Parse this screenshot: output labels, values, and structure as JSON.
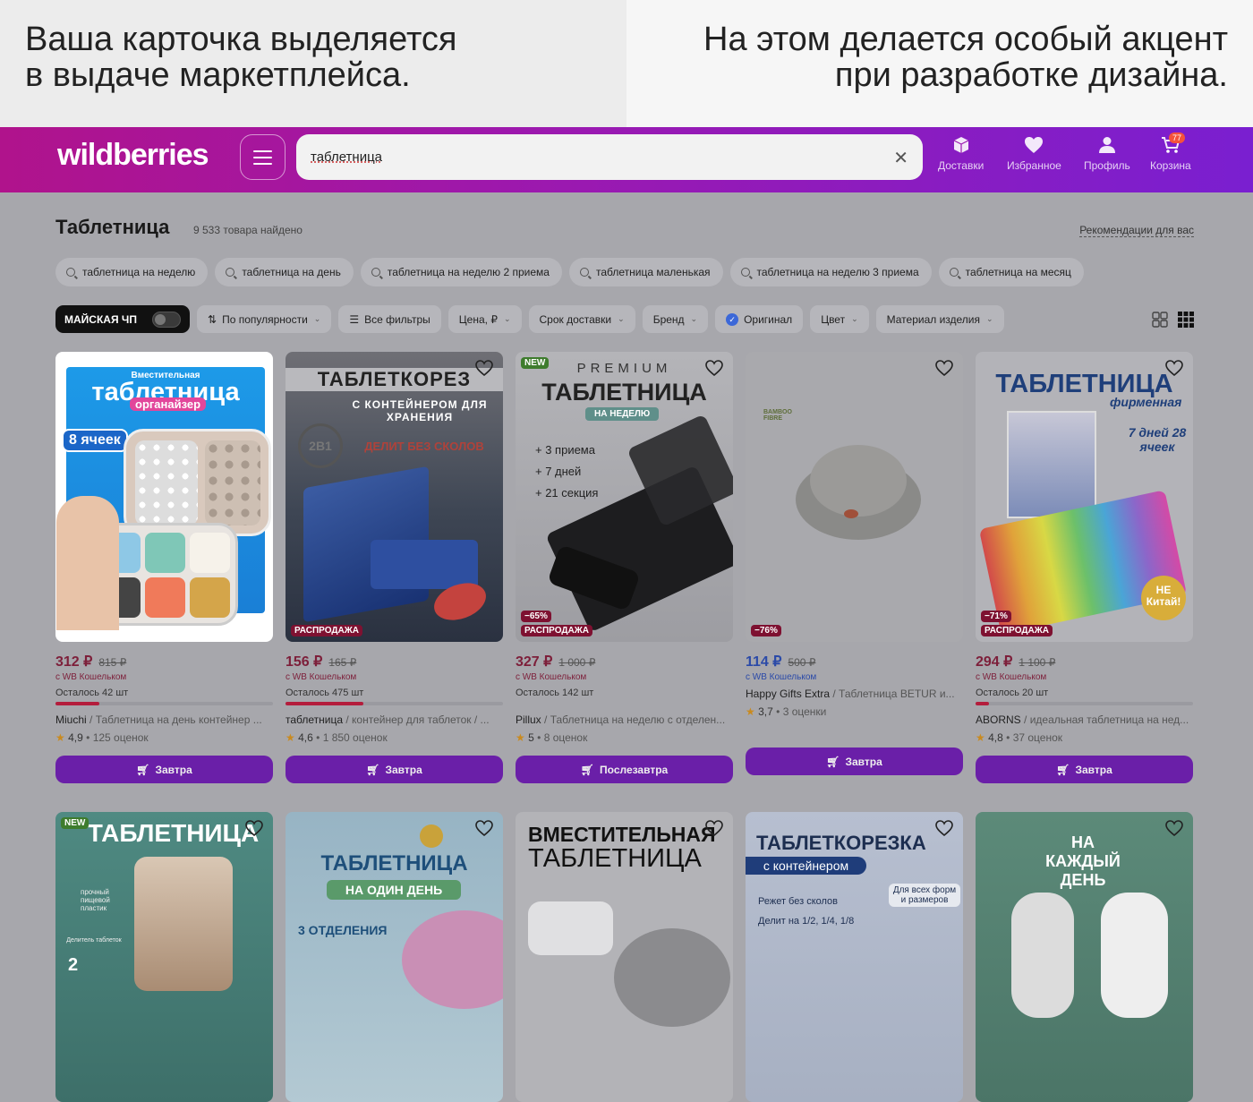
{
  "caption": {
    "left_line1": "Ваша карточка выделяется",
    "left_line2": "в выдаче маркетплейса.",
    "right_line1": "На этом делается особый акцент",
    "right_line2": "при разработке дизайна."
  },
  "header": {
    "logo": "wildberries",
    "search_value": "таблетница",
    "nav": [
      "Доставки",
      "Избранное",
      "Профиль",
      "Корзина"
    ],
    "cart_count": "77",
    "accent_gradient": [
      "#b0138c",
      "#7a1fd0"
    ]
  },
  "results": {
    "title": "Таблетница",
    "count": "9 533 товара найдено",
    "recommend": "Рекомендации для вас"
  },
  "suggestions": [
    "таблетница на неделю",
    "таблетница на день",
    "таблетница на неделю 2 приема",
    "таблетница маленькая",
    "таблетница на неделю 3 приема",
    "таблетница на месяц"
  ],
  "filters": {
    "promo": "МАЙСКАЯ ЧП",
    "sort": "По популярности",
    "all": "Все фильтры",
    "price": "Цена, ₽",
    "delivery": "Срок доставки",
    "brand": "Бренд",
    "original": "Оригинал",
    "color": "Цвет",
    "material": "Материал изделия"
  },
  "products": [
    {
      "price": "312 ₽",
      "old": "815 ₽",
      "wallet": "с WB Кошельком",
      "left": "Осталось 42 шт",
      "stock": 0.2,
      "brand": "Miuchi",
      "name": " / Таблетница на день контейнер ...",
      "rating": "4,9",
      "reviews": "125 оценок",
      "button": "Завтра",
      "img_title": "таблетница",
      "img_sub": "органайзер",
      "img_small": "Вместительная",
      "img_count": "8 ячеек"
    },
    {
      "price": "156 ₽",
      "old": "165 ₽",
      "wallet": "с WB Кошельком",
      "left": "Осталось 475 шт",
      "stock": 0.36,
      "brand": "таблетница",
      "name": " / контейнер для таблеток / ...",
      "rating": "4,6",
      "reviews": "1 850 оценок",
      "button": "Завтра",
      "img_title": "ТАБЛЕТКОРЕЗ",
      "img_sub": "С КОНТЕЙНЕРОМ ДЛЯ ХРАНЕНИЯ",
      "img_small": "ДЕЛИТ БЕЗ СКОЛОВ",
      "img_count": "2В1",
      "sale": "РАСПРОДАЖА"
    },
    {
      "price": "327 ₽",
      "old": "1 000 ₽",
      "wallet": "с WB Кошельком",
      "left": "Осталось 142 шт",
      "stock": 0,
      "brand": "Pillux",
      "name": " / Таблетница на неделю с отделен...",
      "rating": "5",
      "reviews": "8 оценок",
      "button": "Послезавтра",
      "img_title": "ТАБЛЕТНИЦА",
      "img_sub": "НА НЕДЕЛЮ",
      "img_small": "PREMIUM",
      "feat": [
        "+ 3 приема",
        "+ 7 дней",
        "+ 21 секция"
      ],
      "new": "NEW",
      "disc": "−65%",
      "sale": "РАСПРОДАЖА"
    },
    {
      "price": "114 ₽",
      "old": "500 ₽",
      "wallet": "с WB Кошельком",
      "left": "",
      "stock": 0,
      "brand": "Happy Gifts Extra",
      "name": " / Таблетница BETUR и...",
      "rating": "3,7",
      "reviews": "3 оценки",
      "button": "Завтра",
      "img_small": "BAMBOO FIBRE",
      "disc": "−76%"
    },
    {
      "price": "294 ₽",
      "old": "1 100 ₽",
      "wallet": "с WB Кошельком",
      "left": "Осталось 20 шт",
      "stock": 0.06,
      "brand": "ABORNS",
      "name": " / идеальная таблетница на нед...",
      "rating": "4,8",
      "reviews": "37 оценок",
      "button": "Завтра",
      "img_title": "ТАБЛЕТНИЦА",
      "img_sub": "фирменная",
      "img_small": "7 дней 28 ячеек",
      "img_count": "НЕ Китай!",
      "disc": "−71%",
      "sale": "РАСПРОДАЖА"
    }
  ],
  "products_row2": [
    {
      "img_title": "ТАБЛЕТНИЦА",
      "new": "NEW",
      "img_sub": "прочный пищевой пластик",
      "img_small": "Делитель таблеток",
      "img_count": "2"
    },
    {
      "img_title": "ТАБЛЕТНИЦА",
      "img_sub": "НА ОДИН ДЕНЬ",
      "img_small": "3 ОТДЕЛЕНИЯ"
    },
    {
      "img_title": "ВМЕСТИТЕЛЬНАЯ",
      "img_sub": "ТАБЛЕТНИЦА"
    },
    {
      "img_title": "ТАБЛЕТКОРЕЗКА",
      "img_sub": "с контейнером",
      "img_small": "Режет без сколов",
      "img_count": "Делит на 1/2, 1/4, 1/8",
      "img_extra": "Для всех форм и размеров"
    },
    {
      "img_title": "НА КАЖДЫЙ ДЕНЬ"
    }
  ]
}
